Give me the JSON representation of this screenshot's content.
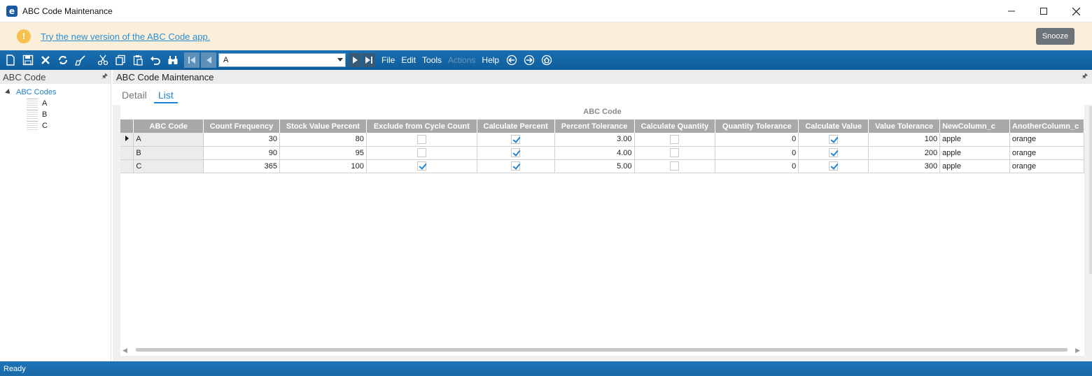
{
  "window": {
    "title": "ABC Code Maintenance",
    "app_icon": "e",
    "controls": [
      "minimize-icon",
      "maximize-icon",
      "close-icon"
    ]
  },
  "banner": {
    "link_text": "Try the new version of the ABC Code app.",
    "snooze_label": "Snooze",
    "icon": "!"
  },
  "toolbar": {
    "icons": [
      "new-icon",
      "save-icon",
      "delete-icon",
      "refresh-icon",
      "clear-icon",
      "cut-icon",
      "copy-icon",
      "paste-icon",
      "undo-icon",
      "search-icon"
    ],
    "combo_value": "A",
    "menus": [
      "File",
      "Edit",
      "Tools",
      "Actions",
      "Help"
    ],
    "disabled_menu": "Actions"
  },
  "tree": {
    "panel_title": "ABC Code",
    "root_label": "ABC Codes",
    "leaves": [
      "A",
      "B",
      "C"
    ]
  },
  "main": {
    "panel_title": "ABC Code Maintenance",
    "tabs": [
      "Detail",
      "List"
    ],
    "active_tab": "List",
    "grid_caption": "ABC Code",
    "columns": [
      "ABC Code",
      "Count Frequency",
      "Stock Value Percent",
      "Exclude from Cycle Count",
      "Calculate Percent",
      "Percent Tolerance",
      "Calculate Quantity",
      "Quantity Tolerance",
      "Calculate Value",
      "Value Tolerance",
      "NewColumn_c",
      "AnotherColumn_c"
    ],
    "rows": [
      {
        "code": "A",
        "count_frequency": "30",
        "stock_value_percent": "80",
        "exclude": false,
        "calc_percent": true,
        "percent_tolerance": "3.00",
        "calc_quantity": false,
        "quantity_tolerance": "0",
        "calc_value": true,
        "value_tolerance": "100",
        "new_column": "apple",
        "another_column": "orange"
      },
      {
        "code": "B",
        "count_frequency": "90",
        "stock_value_percent": "95",
        "exclude": false,
        "calc_percent": true,
        "percent_tolerance": "4.00",
        "calc_quantity": false,
        "quantity_tolerance": "0",
        "calc_value": true,
        "value_tolerance": "200",
        "new_column": "apple",
        "another_column": "orange"
      },
      {
        "code": "C",
        "count_frequency": "365",
        "stock_value_percent": "100",
        "exclude": true,
        "calc_percent": true,
        "percent_tolerance": "5.00",
        "calc_quantity": false,
        "quantity_tolerance": "0",
        "calc_value": true,
        "value_tolerance": "300",
        "new_column": "apple",
        "another_column": "orange"
      }
    ]
  },
  "status": {
    "text": "Ready"
  },
  "colors": {
    "toolbar_blue": "#1a6fb0",
    "banner_bg": "#fcefd9",
    "link_blue": "#2a8fd4",
    "header_gray": "#a9a9a9",
    "check_blue": "#1f84d4"
  }
}
